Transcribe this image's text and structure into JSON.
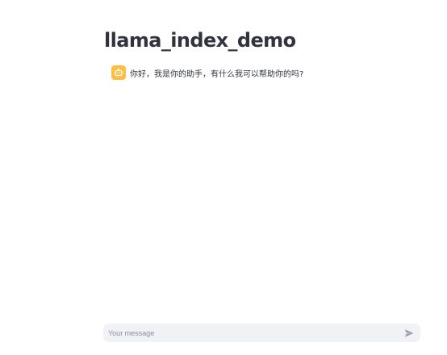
{
  "app": {
    "title": "llama_index_demo"
  },
  "chat": {
    "messages": [
      {
        "role": "assistant",
        "avatar_icon": "robot-icon",
        "avatar_color": "#ffbd45",
        "text": "你好，我是你的助手，有什么我可以帮助你的吗?"
      }
    ]
  },
  "input": {
    "placeholder": "Your message",
    "value": "",
    "send_icon": "send-icon"
  },
  "colors": {
    "text": "#31333f",
    "input_bg": "#f0f2f6",
    "placeholder": "#8d8f97",
    "avatar": "#ffbd45"
  }
}
